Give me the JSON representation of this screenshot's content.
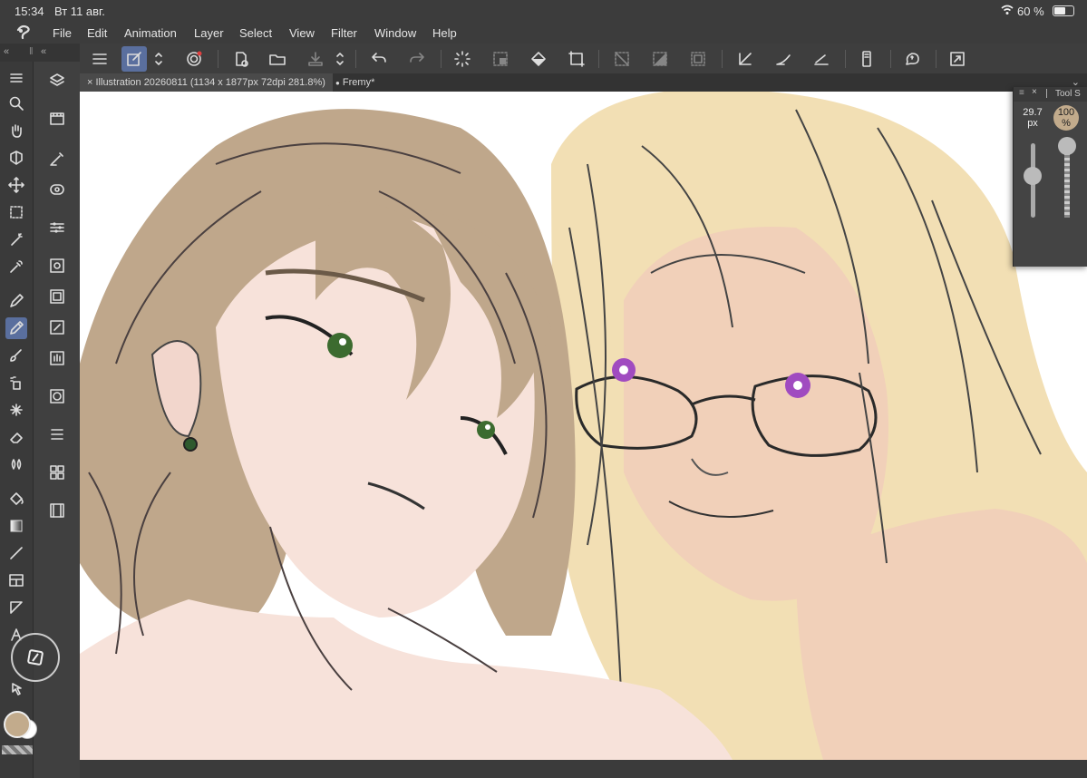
{
  "status": {
    "time": "15:34",
    "date": "Вт 11 авг.",
    "battery": "60 %"
  },
  "menu": [
    "File",
    "Edit",
    "Animation",
    "Layer",
    "Select",
    "View",
    "Filter",
    "Window",
    "Help"
  ],
  "tabs": [
    {
      "close": "×",
      "label": "Illustration 20260811 (1134 x 1877px 72dpi 281.8%)"
    },
    {
      "close": "●",
      "label": "Fremy*"
    }
  ],
  "tool_panel": {
    "title": "Tool S",
    "brush_size": "29.7",
    "brush_unit": "px",
    "opacity": "100",
    "opacity_unit": "%"
  },
  "colors": {
    "main": "#c2ab8c",
    "sub": "#ffffff"
  }
}
